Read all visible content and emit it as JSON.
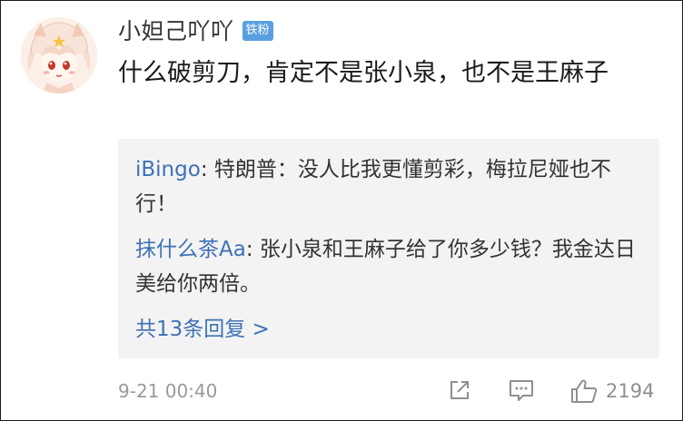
{
  "comment": {
    "username": "小妲己吖吖",
    "badge": "铁粉",
    "text": "什么破剪刀，肯定不是张小泉，也不是王麻子",
    "time": "9-21 00:40",
    "like_count": "2194"
  },
  "replies": [
    {
      "user": "iBingo",
      "separator": ": ",
      "text": "特朗普：没人比我更懂剪彩，梅拉尼娅也不行！"
    },
    {
      "user": "抹什么茶Aa",
      "separator": ": ",
      "text": "张小泉和王麻子给了你多少钱？我金达日美给你两倍。"
    }
  ],
  "more_replies": "共13条回复 >",
  "colors": {
    "link_blue": "#3e72b6",
    "badge_blue": "#5a9fe0",
    "reply_bg": "#f3f3f3",
    "meta_gray": "#9a9a9a"
  },
  "icons": [
    "avatar-anime-girl",
    "share-icon",
    "comment-icon",
    "thumbs-up-icon"
  ]
}
